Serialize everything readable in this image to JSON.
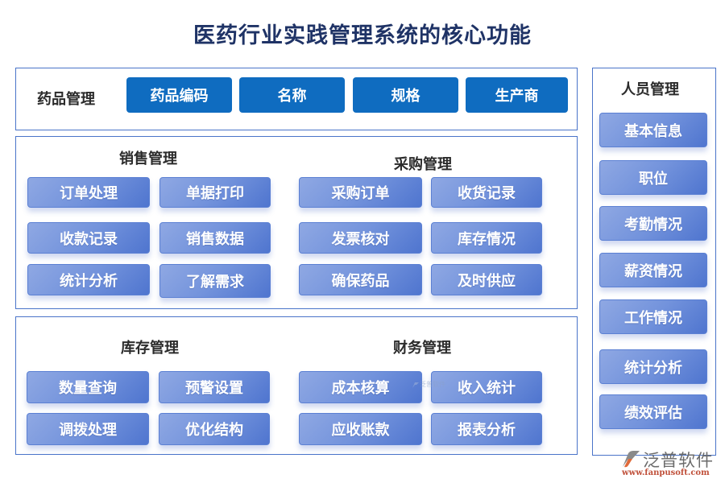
{
  "title": "医药行业实践管理系统的核心功能",
  "drug": {
    "heading": "药品管理",
    "buttons": [
      "药品编码",
      "名称",
      "规格",
      "生产商"
    ]
  },
  "sales": {
    "heading": "销售管理",
    "buttons": [
      "订单处理",
      "单据打印",
      "收款记录",
      "销售数据",
      "统计分析",
      "了解需求"
    ]
  },
  "purchase": {
    "heading": "采购管理",
    "buttons": [
      "采购订单",
      "收货记录",
      "发票核对",
      "库存情况",
      "确保药品",
      "及时供应"
    ]
  },
  "inventory": {
    "heading": "库存管理",
    "buttons": [
      "数量查询",
      "预警设置",
      "调拨处理",
      "优化结构"
    ]
  },
  "finance": {
    "heading": "财务管理",
    "buttons": [
      "成本核算",
      "收入统计",
      "应收账款",
      "报表分析"
    ]
  },
  "hr": {
    "heading": "人员管理",
    "buttons": [
      "基本信息",
      "职位",
      "考勤情况",
      "薪资情况",
      "工作情况",
      "统计分析",
      "绩效评估"
    ]
  },
  "logo": {
    "name": "泛普软件",
    "url": "www.fanpusoft.com",
    "icon": "fanpu-logo-icon"
  },
  "watermark": "泛普软件",
  "colors": {
    "title": "#1f3366",
    "panel_border": "#4a74c9",
    "solid_button": "#0f6cc0",
    "gradient_button_light": "#8fa8e3",
    "gradient_button_dark": "#4f75cf"
  }
}
